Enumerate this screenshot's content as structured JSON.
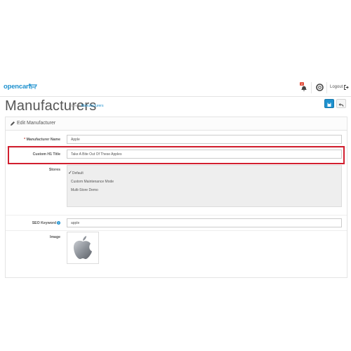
{
  "header": {
    "logo_text": "opencart",
    "notifications_count": "2",
    "logout_label": "Logout"
  },
  "page": {
    "title": "Manufacturers",
    "breadcrumb": [
      "Home",
      "/",
      "Manufacturers"
    ]
  },
  "panel": {
    "title": "Edit Manufacturer",
    "fields": {
      "name_label": "Manufacturer Name",
      "name_value": "Apple",
      "h1_label": "Custom H1 Title",
      "h1_value": "Take A Bite Out Of These Apples",
      "stores_label": "Stores",
      "stores": [
        {
          "name": "Default",
          "checked": true
        },
        {
          "name": "Custom Maintenance Mode",
          "checked": false
        },
        {
          "name": "Multi-Store Demo",
          "checked": false
        }
      ],
      "seo_label": "SEO Keyword",
      "seo_value": "apple",
      "image_label": "Image"
    }
  },
  "colors": {
    "brand_blue": "#1e91cf",
    "highlight_red": "#d21f2f",
    "badge_red": "#e3503e"
  },
  "icons": [
    "cart-icon",
    "bell-icon",
    "lifering-icon",
    "sign-out-icon",
    "save-icon",
    "reply-icon",
    "pencil-icon",
    "info-icon",
    "apple-logo-icon"
  ]
}
